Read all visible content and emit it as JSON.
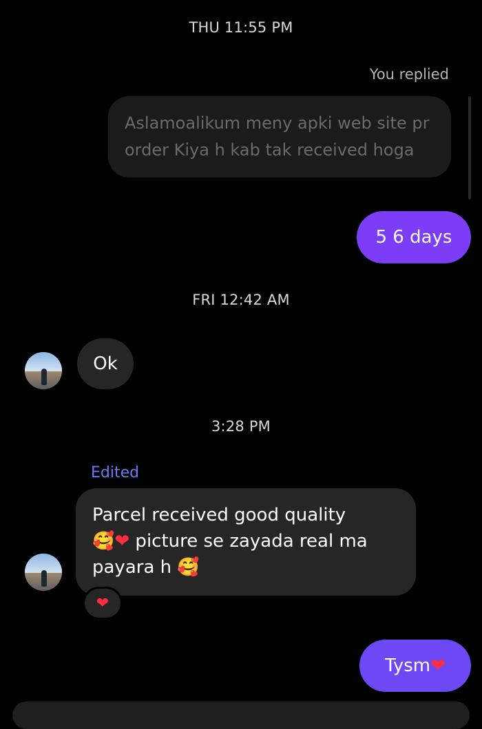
{
  "thread": {
    "timestamps": [
      "THU 11:55 PM",
      "FRI 12:42 AM",
      "3:28 PM"
    ],
    "reply_context": {
      "label": "You replied",
      "quoted_text": "Aslamoalikum meny apki web site pr order Kiya h kab tak received hoga"
    },
    "messages": [
      {
        "from": "me",
        "text": "5 6 days"
      },
      {
        "from": "them",
        "text": "Ok"
      },
      {
        "from": "them",
        "edited_label": "Edited",
        "line1": "Parcel received good quality",
        "line2_emoji_a": "🥰",
        "line2_emoji_b": "❤",
        "line2_text": " picture se zayada real ma",
        "line3_text": "payara h ",
        "line3_emoji": "🥰",
        "reaction": "❤"
      },
      {
        "from": "me",
        "text": "Tysm",
        "emoji": "❤"
      }
    ]
  },
  "colors": {
    "background": "#000000",
    "sent_bubble": "#7b3df5",
    "received_bubble": "#262626",
    "edited_label": "#6b7cf0",
    "heart": "#ff2d3f"
  }
}
